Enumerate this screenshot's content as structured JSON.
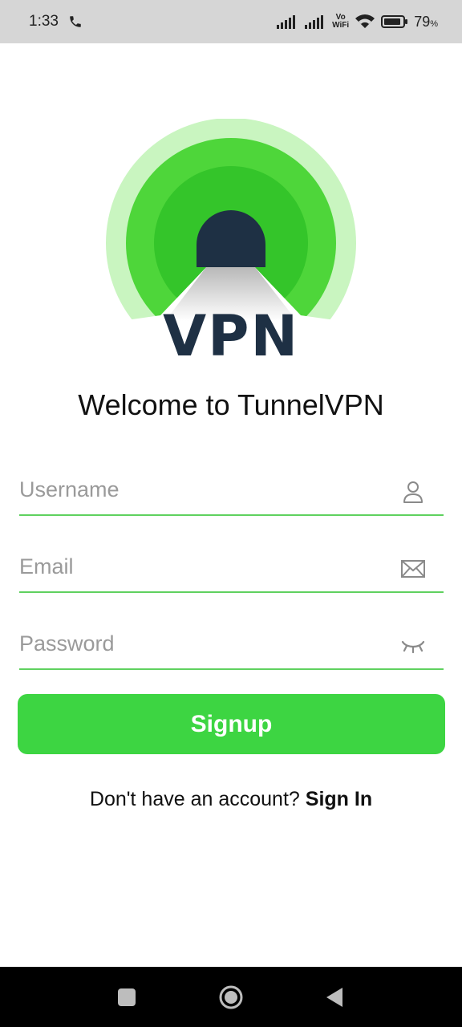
{
  "status_bar": {
    "time": "1:33",
    "vowifi_top": "Vo",
    "vowifi_bottom": "WiFi",
    "battery_percent": "79",
    "percent_sign": "%"
  },
  "logo": {
    "text": "VPN"
  },
  "welcome_title": "Welcome to TunnelVPN",
  "form": {
    "username_placeholder": "Username",
    "email_placeholder": "Email",
    "password_placeholder": "Password"
  },
  "signup_label": "Signup",
  "signin_prompt": "Don't have an account? ",
  "signin_link": "Sign In",
  "colors": {
    "accent": "#3dd542",
    "logo_dark": "#1e3044",
    "field_line": "#5fd15f"
  }
}
